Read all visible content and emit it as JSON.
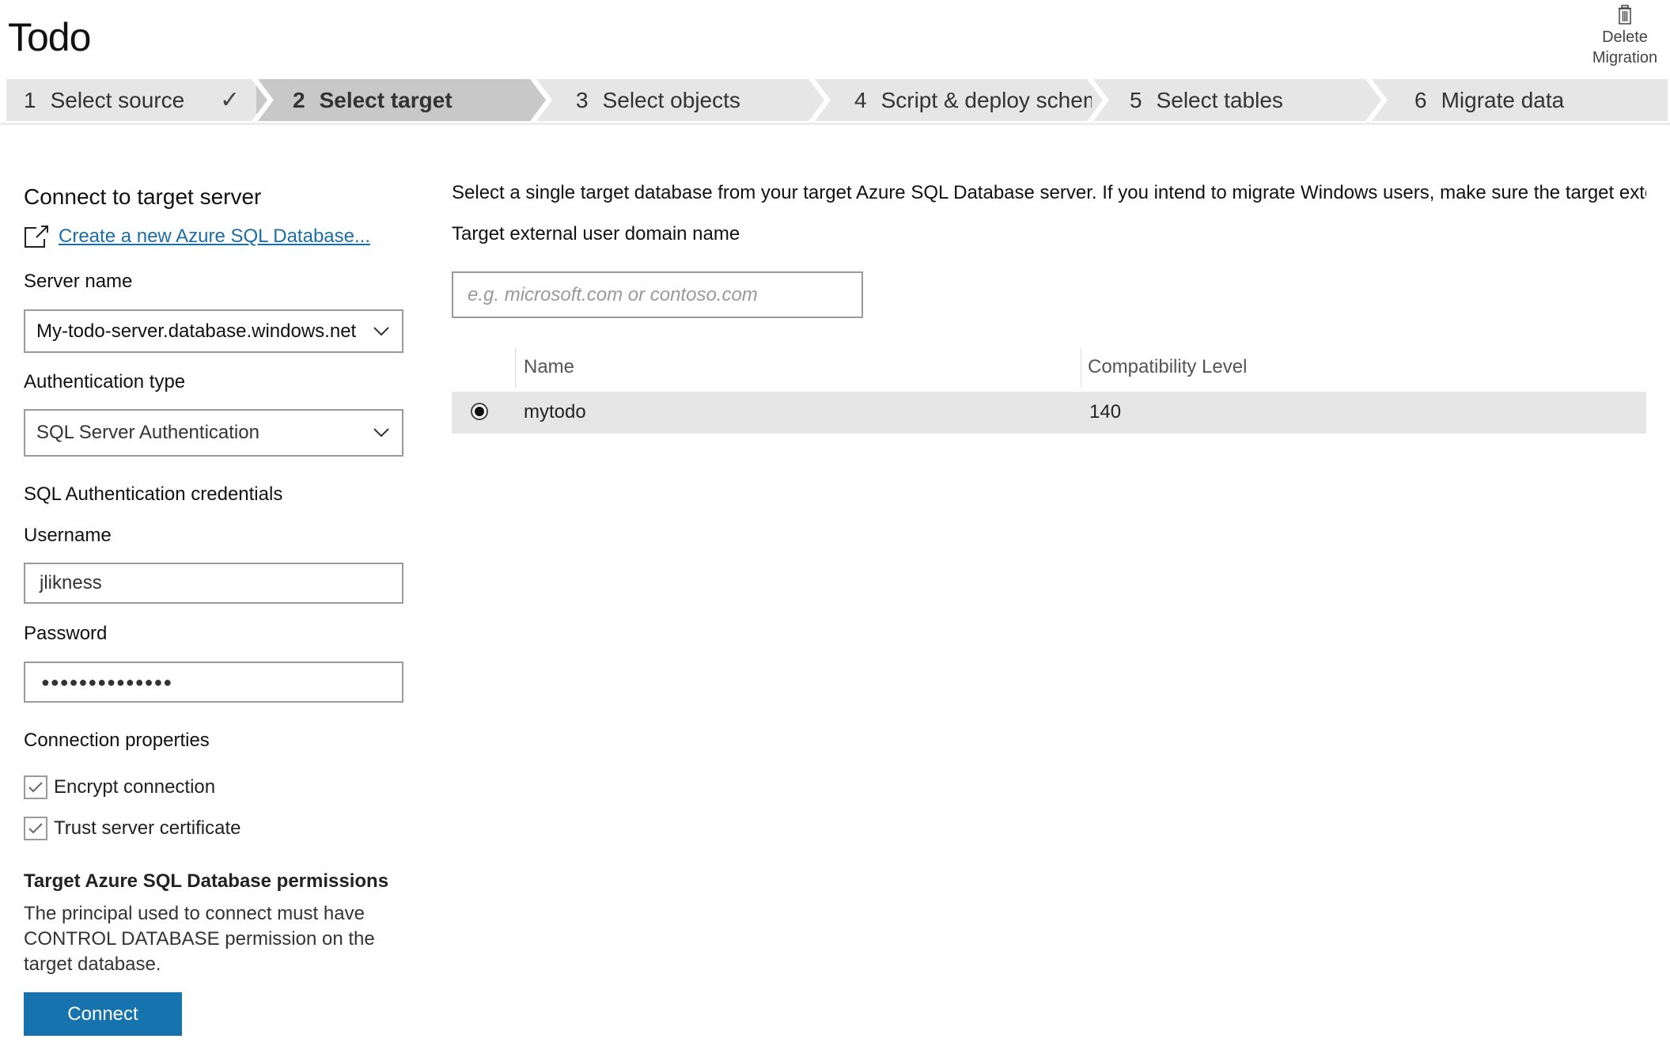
{
  "header": {
    "title": "Todo",
    "delete_migration": {
      "line1": "Delete",
      "line2": "Migration",
      "icon": "trash-icon"
    }
  },
  "steps": [
    {
      "number": "1",
      "label": "Select source",
      "state": "completed"
    },
    {
      "number": "2",
      "label": "Select target",
      "state": "active"
    },
    {
      "number": "3",
      "label": "Select objects",
      "state": "pending"
    },
    {
      "number": "4",
      "label": "Script & deploy schema",
      "display_label": "Script & deploy schem",
      "state": "pending"
    },
    {
      "number": "5",
      "label": "Select tables",
      "state": "pending"
    },
    {
      "number": "6",
      "label": "Migrate data",
      "state": "pending"
    }
  ],
  "left_panel": {
    "heading": "Connect to target server",
    "create_link": "Create a new Azure SQL Database...",
    "server_name": {
      "label": "Server name",
      "value": "My-todo-server.database.windows.net"
    },
    "auth_type": {
      "label": "Authentication type",
      "value": "SQL Server Authentication"
    },
    "credentials_heading": "SQL Authentication credentials",
    "username": {
      "label": "Username",
      "value": "jlikness"
    },
    "password": {
      "label": "Password",
      "masked_value": "●●●●●●●●●●●●●●"
    },
    "connection_properties": {
      "heading": "Connection properties",
      "options": [
        {
          "label": "Encrypt connection",
          "checked": true
        },
        {
          "label": "Trust server certificate",
          "checked": true
        }
      ]
    },
    "permissions": {
      "heading": "Target Azure SQL Database permissions",
      "text": "The principal used to connect must have CONTROL DATABASE permission on the target database."
    },
    "connect_button": "Connect"
  },
  "right_panel": {
    "instruction": "Select a single target database from your target Azure SQL Database server. If you intend to migrate Windows users, make sure the target exte",
    "domain_label": "Target external user domain name",
    "domain_input": {
      "value": "",
      "placeholder": "e.g. microsoft.com or contoso.com"
    },
    "table": {
      "columns": [
        "Name",
        "Compatibility Level"
      ],
      "rows": [
        {
          "selected": true,
          "name": "mytodo",
          "compatibility_level": "140"
        }
      ]
    }
  },
  "colors": {
    "accent": "#1673ad",
    "link": "#1a6ea8",
    "step_bg": "#e6e6e6",
    "step_active_bg": "#c8c8c8",
    "row_selected_bg": "#e6e6e6"
  }
}
